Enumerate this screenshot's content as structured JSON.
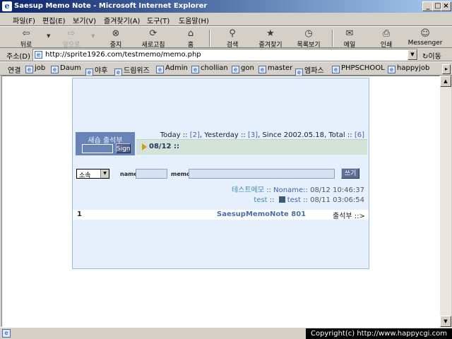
{
  "window": {
    "title": "Saesup Memo Note - Microsoft Internet Explorer",
    "minimize": "_",
    "maximize": "□",
    "close": "×"
  },
  "menu": [
    "파일(F)",
    "편집(E)",
    "보기(V)",
    "즐겨찾기(A)",
    "도구(T)",
    "도움말(H)"
  ],
  "toolbar": {
    "back": "뒤로",
    "forward": "앞으로",
    "stop": "중지",
    "refresh": "새로고침",
    "home": "홈",
    "search": "검색",
    "favorites": "즐겨찾기",
    "history": "목록보기",
    "mail": "메일",
    "print": "인쇄",
    "messenger": "Messenger"
  },
  "address": {
    "label": "주소(D)",
    "url": "http://sprite1926.com/testmemo/memo.php",
    "go": "이동"
  },
  "links": {
    "label": "연결",
    "items": [
      "job",
      "Daum",
      "야후",
      "드림위즈",
      "Admin",
      "chollian",
      "gon",
      "master",
      "엠파스",
      "PHPSCHOOL",
      "happyjob"
    ]
  },
  "page": {
    "cheok_title": "새숍 출석부",
    "sign_label": "Sign",
    "stats": {
      "today_label": "Today ::",
      "today": "[2]",
      "yesterday_label": ", Yesterday ::",
      "yesterday": "[3]",
      "since_label": ", Since 2002.05.18, Total ::",
      "total": "[6]"
    },
    "date_header": "08/12 ::",
    "form": {
      "select_value": "소속",
      "name_label": "name",
      "memo_label": "memo",
      "write_button": "쓰기"
    },
    "messages": [
      {
        "title": "테스트메모",
        "sep": "::",
        "author": "Noname",
        "sep2": "::",
        "time": "08/12 10:46:37"
      },
      {
        "title": "test",
        "sep": "::",
        "author": "test",
        "sep2": "::",
        "time": "08/11 03:06:54"
      }
    ],
    "footer": {
      "page": "1",
      "brand": "SaesupMemoNote 801",
      "cheok_link": "출석부 ::>"
    }
  },
  "status": {
    "copyright": "Copyright(c) http://www.happycgi.com"
  }
}
